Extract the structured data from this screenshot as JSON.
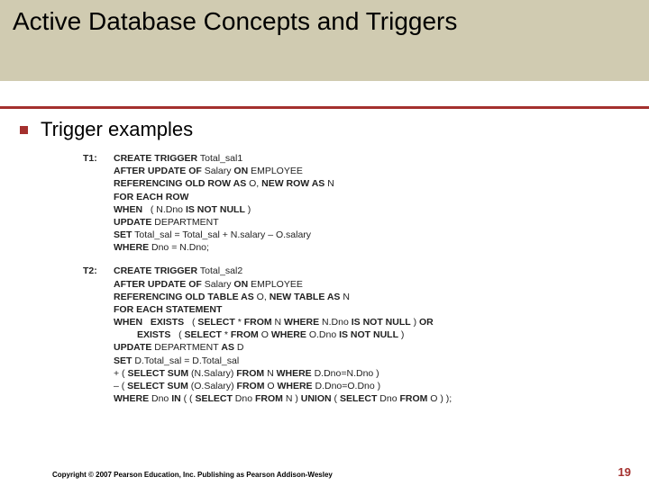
{
  "title": "Active Database Concepts and Triggers",
  "bullet": "Trigger examples",
  "triggers": {
    "t1": {
      "label": "T1:",
      "l1a": "CREATE TRIGGER",
      "l1b": " Total_sal1",
      "l2a": "AFTER UPDATE OF",
      "l2b": " Salary ",
      "l2c": "ON",
      "l2d": " EMPLOYEE",
      "l3a": "REFERENCING OLD ROW AS",
      "l3b": " O, ",
      "l3c": "NEW ROW AS",
      "l3d": " N",
      "l4": "FOR EACH ROW",
      "l5a": "WHEN",
      "l5b": "   ( N.Dno ",
      "l5c": "IS NOT NULL",
      "l5d": " )",
      "l6a": "UPDATE",
      "l6b": " DEPARTMENT",
      "l7a": "SET",
      "l7b": " Total_sal = Total_sal + N.salary – O.salary",
      "l8a": "WHERE",
      "l8b": " Dno = N.Dno;"
    },
    "t2": {
      "label": "T2:",
      "l1a": "CREATE TRIGGER",
      "l1b": " Total_sal2",
      "l2a": "AFTER UPDATE OF",
      "l2b": " Salary ",
      "l2c": "ON",
      "l2d": " EMPLOYEE",
      "l3a": "REFERENCING OLD TABLE AS",
      "l3b": " O, ",
      "l3c": "NEW TABLE AS",
      "l3d": " N",
      "l4": "FOR EACH STATEMENT",
      "l5a": "WHEN   EXISTS",
      "l5b": "   ( ",
      "l5c": "SELECT",
      "l5d": " * ",
      "l5e": "FROM",
      "l5f": " N ",
      "l5g": "WHERE",
      "l5h": " N.Dno ",
      "l5i": "IS NOT NULL",
      "l5j": " ) ",
      "l5k": "OR",
      "l6a": "EXISTS",
      "l6b": "   ( ",
      "l6c": "SELECT",
      "l6d": " * ",
      "l6e": "FROM",
      "l6f": " O ",
      "l6g": "WHERE",
      "l6h": " O.Dno ",
      "l6i": "IS NOT NULL",
      "l6j": " )",
      "l7a": "UPDATE",
      "l7b": " DEPARTMENT ",
      "l7c": "AS",
      "l7d": " D",
      "l8a": "SET",
      "l8b": " D.Total_sal = D.Total_sal",
      "l9a": "+ ( ",
      "l9b": "SELECT SUM",
      "l9c": " (N.Salary) ",
      "l9d": "FROM",
      "l9e": " N ",
      "l9f": "WHERE",
      "l9g": " D.Dno=N.Dno )",
      "l10a": "– ( ",
      "l10b": "SELECT SUM",
      "l10c": " (O.Salary) ",
      "l10d": "FROM",
      "l10e": " O ",
      "l10f": "WHERE",
      "l10g": " D.Dno=O.Dno )",
      "l11a": "WHERE",
      "l11b": " Dno ",
      "l11c": "IN",
      "l11d": " ( ( ",
      "l11e": "SELECT",
      "l11f": " Dno ",
      "l11g": "FROM",
      "l11h": " N ) ",
      "l11i": "UNION",
      "l11j": " ( ",
      "l11k": "SELECT",
      "l11l": " Dno ",
      "l11m": "FROM",
      "l11n": " O ) );"
    }
  },
  "footer": {
    "copyright": "Copyright © 2007 Pearson Education, Inc. Publishing as Pearson Addison-Wesley",
    "page": "19"
  }
}
